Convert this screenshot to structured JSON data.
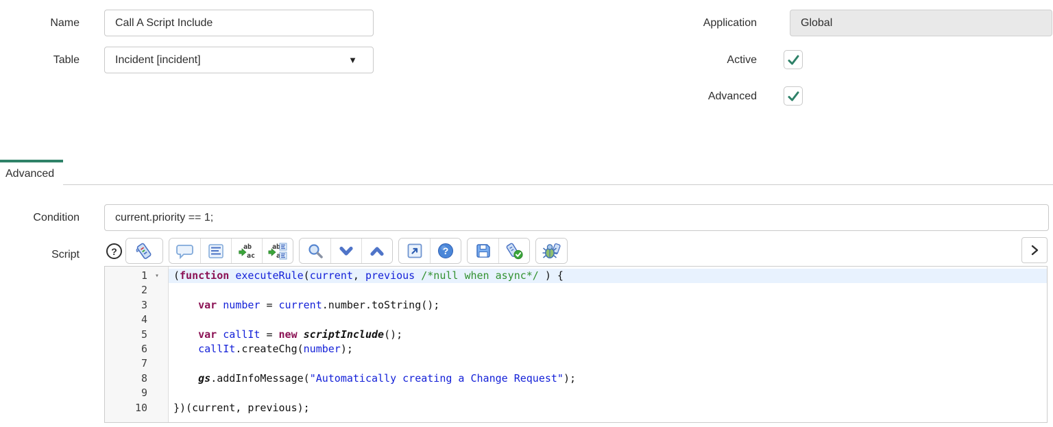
{
  "form": {
    "name_label": "Name",
    "name_value": "Call A Script Include",
    "table_label": "Table",
    "table_value": "Incident [incident]",
    "application_label": "Application",
    "application_value": "Global",
    "active_label": "Active",
    "active_checked": true,
    "advanced_label": "Advanced",
    "advanced_checked": true
  },
  "tab": {
    "label": "Advanced",
    "active": true
  },
  "condition": {
    "label": "Condition",
    "value": "current.priority == 1;"
  },
  "script": {
    "label": "Script",
    "help_icon": "?",
    "toolbar_groups": [
      [
        "script-editor-toggle"
      ],
      [
        "toggle-comment",
        "format-code",
        "replace",
        "replace-all"
      ],
      [
        "search",
        "find-next",
        "find-previous"
      ],
      [
        "open-fullscreen",
        "editor-help"
      ],
      [
        "save",
        "syntax-check"
      ],
      [
        "start-debugger"
      ]
    ],
    "editor": {
      "lines": [
        {
          "num": 1,
          "fold": true,
          "active": true,
          "tokens": [
            [
              "p",
              "("
            ],
            [
              "k",
              "function"
            ],
            [
              "p",
              " "
            ],
            [
              "v",
              "executeRule"
            ],
            [
              "p",
              "("
            ],
            [
              "v",
              "current"
            ],
            [
              "p",
              ", "
            ],
            [
              "v",
              "previous"
            ],
            [
              "p",
              " "
            ],
            [
              "c",
              "/*null when async*/"
            ],
            [
              "p",
              " ) {"
            ]
          ]
        },
        {
          "num": 2,
          "tokens": []
        },
        {
          "num": 3,
          "tokens": [
            [
              "p",
              "    "
            ],
            [
              "k",
              "var"
            ],
            [
              "p",
              " "
            ],
            [
              "v",
              "number"
            ],
            [
              "p",
              " = "
            ],
            [
              "v",
              "current"
            ],
            [
              "p",
              ".number.toString();"
            ]
          ]
        },
        {
          "num": 4,
          "tokens": []
        },
        {
          "num": 5,
          "tokens": [
            [
              "p",
              "    "
            ],
            [
              "k",
              "var"
            ],
            [
              "p",
              " "
            ],
            [
              "v",
              "callIt"
            ],
            [
              "p",
              " = "
            ],
            [
              "k",
              "new"
            ],
            [
              "p",
              " "
            ],
            [
              "g",
              "scriptInclude"
            ],
            [
              "p",
              "();"
            ]
          ]
        },
        {
          "num": 6,
          "tokens": [
            [
              "p",
              "    "
            ],
            [
              "v",
              "callIt"
            ],
            [
              "p",
              ".createChg("
            ],
            [
              "v",
              "number"
            ],
            [
              "p",
              ");"
            ]
          ]
        },
        {
          "num": 7,
          "tokens": []
        },
        {
          "num": 8,
          "tokens": [
            [
              "p",
              "    "
            ],
            [
              "g",
              "gs"
            ],
            [
              "p",
              ".addInfoMessage("
            ],
            [
              "s",
              "\"Automatically creating a Change Request\""
            ],
            [
              "p",
              ");"
            ]
          ]
        },
        {
          "num": 9,
          "tokens": []
        },
        {
          "num": 10,
          "tokens": [
            [
              "p",
              "})(current, previous);"
            ]
          ]
        }
      ]
    }
  },
  "icons": {
    "dropdown": "▼",
    "fold": "▾"
  },
  "colors": {
    "check_green": "#2E8168",
    "tab_green": "#2E8268",
    "keyword": "#8B1254",
    "variable": "#1421D8",
    "comment": "#31912F",
    "string": "#1421D8",
    "active_line_bg": "#E8F2FE"
  }
}
